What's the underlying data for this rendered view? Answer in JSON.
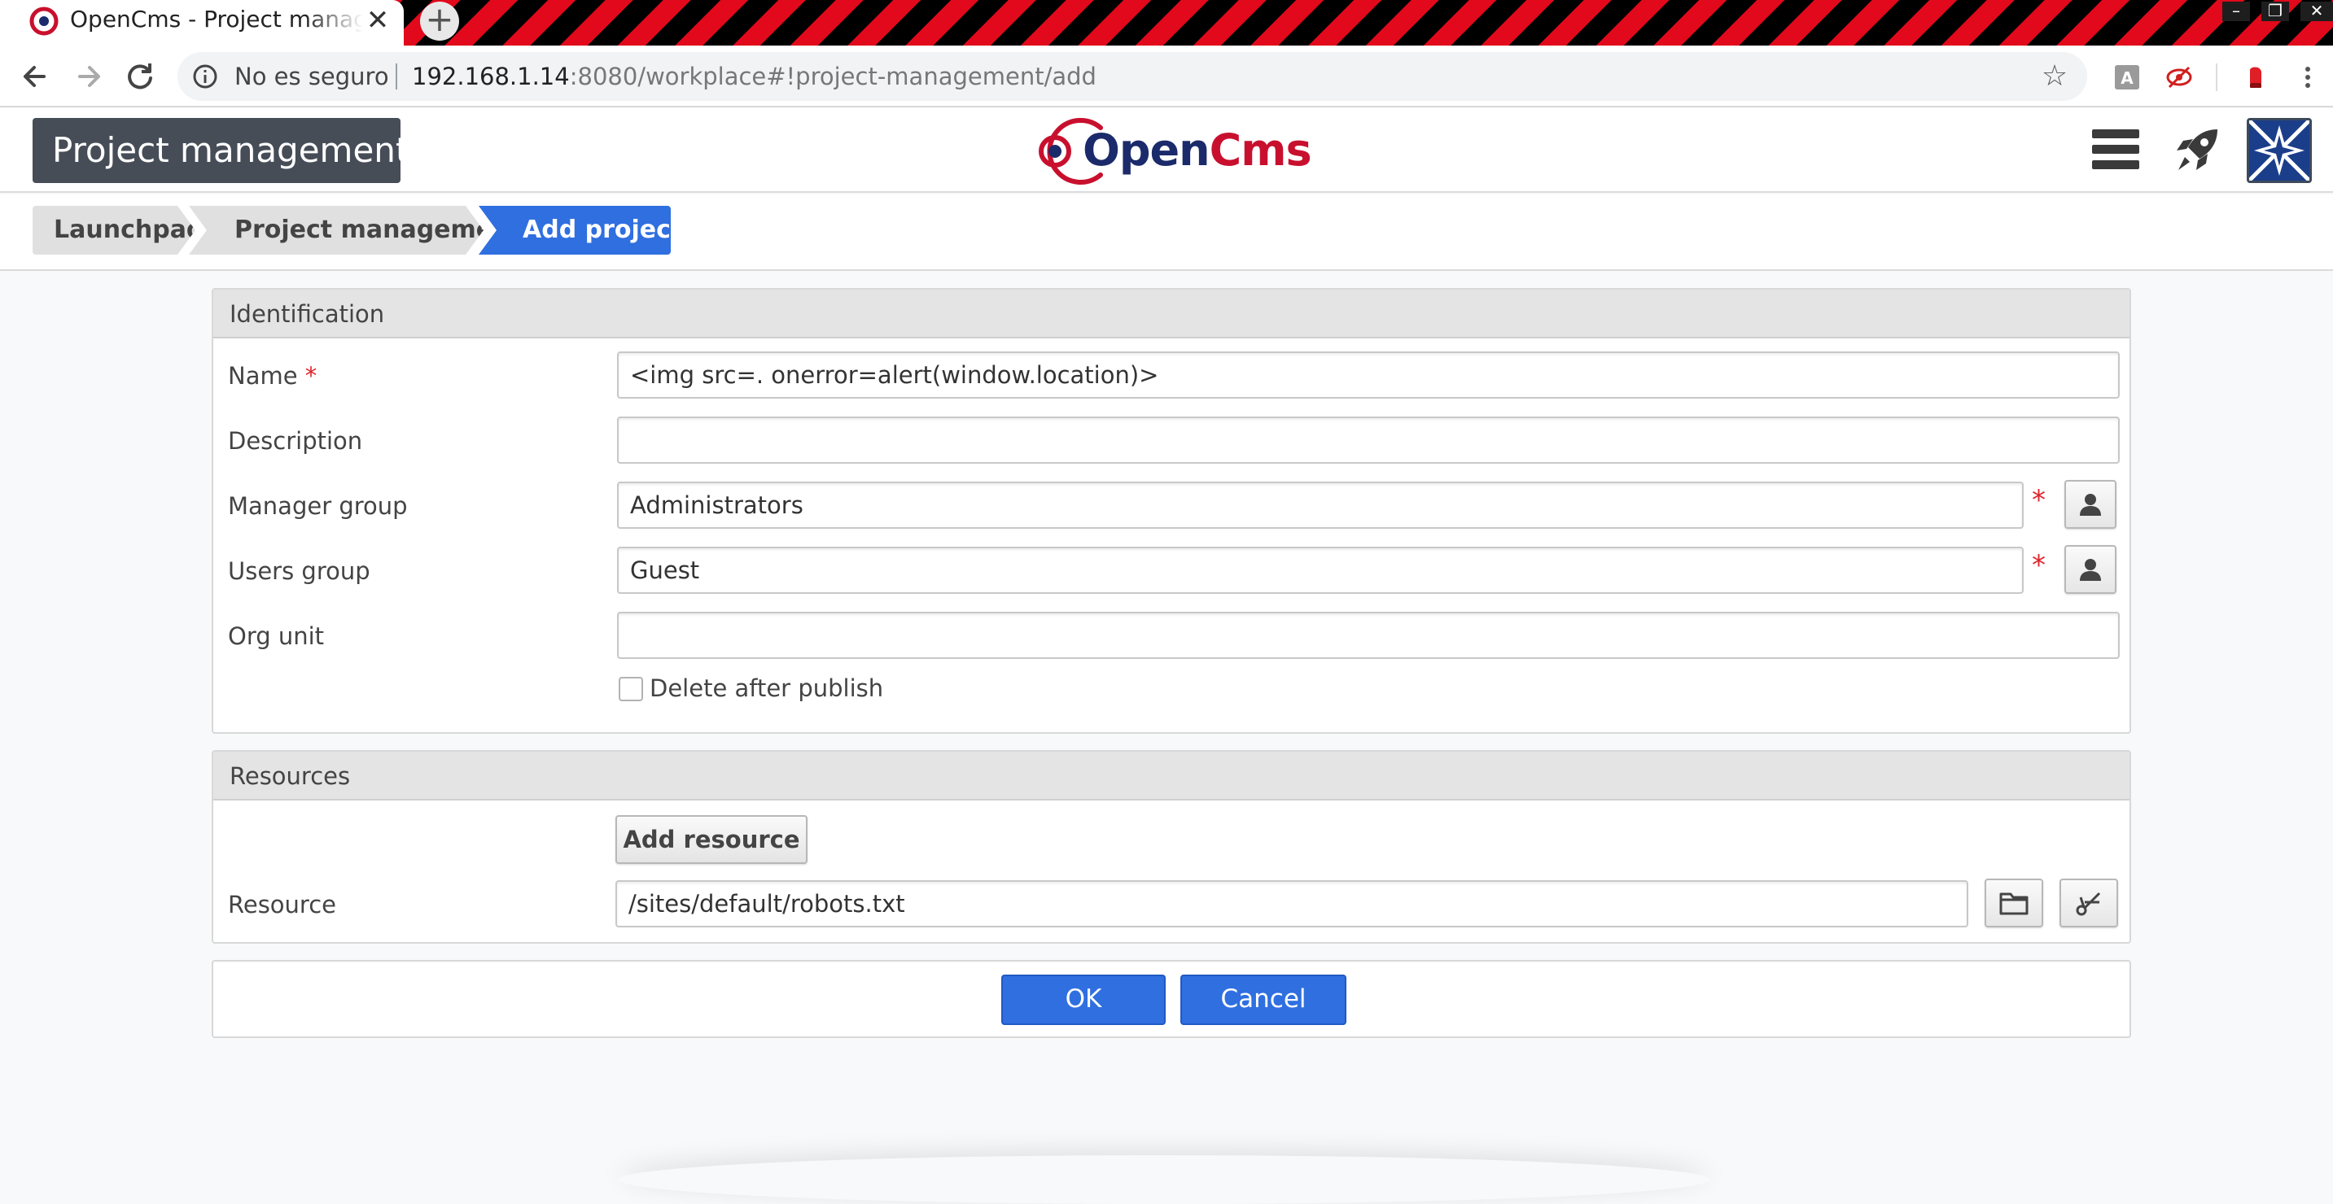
{
  "browser": {
    "tab_title": "OpenCms - Project management",
    "new_tab": "+",
    "tab_close": "✕",
    "security_label": "No es seguro",
    "url_host": "192.168.1.14",
    "url_rest": ":8080/workplace#!project-management/add"
  },
  "app": {
    "title": "Project management",
    "logo_text": "OpenCms"
  },
  "breadcrumb": [
    "Launchpad",
    "Project management",
    "Add project"
  ],
  "identification": {
    "heading": "Identification",
    "name_label": "Name",
    "name_value": "<img src=. onerror=alert(window.location)>",
    "description_label": "Description",
    "description_value": "",
    "manager_group_label": "Manager group",
    "manager_group_value": "Administrators",
    "users_group_label": "Users group",
    "users_group_value": "Guest",
    "org_unit_label": "Org unit",
    "org_unit_value": "",
    "delete_after_publish_label": "Delete after publish",
    "delete_after_publish_checked": false,
    "required_marker": "*"
  },
  "resources": {
    "heading": "Resources",
    "add_resource_label": "Add resource",
    "resource_label": "Resource",
    "resource_value": "/sites/default/robots.txt"
  },
  "actions": {
    "ok_label": "OK",
    "cancel_label": "Cancel"
  },
  "colors": {
    "accent": "#2f6fe0",
    "header_tag": "#474d57",
    "required": "#e0242b",
    "logo_red": "#c8102e",
    "logo_navy": "#1b2a6b"
  }
}
